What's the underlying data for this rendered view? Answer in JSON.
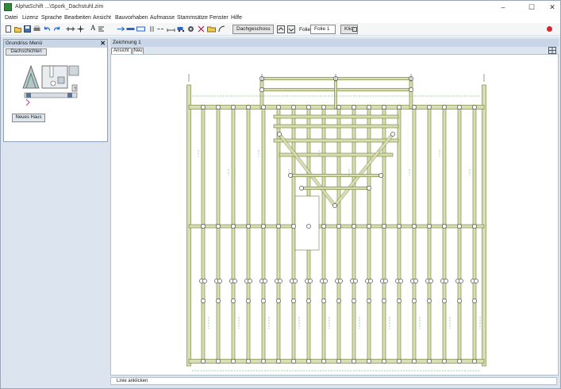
{
  "window": {
    "title": "AlphaSchift ...\\Spork_Dachstuhl.zim",
    "minimize": "–",
    "maximize": "☐",
    "close": "✕"
  },
  "menu": [
    "Datei",
    "Lizenz",
    "Sprache",
    "Bearbeiten",
    "Ansicht",
    "Bauvorhaben",
    "Aufmasse",
    "Stammsätze",
    "Fenster",
    "Hilfe"
  ],
  "toolbar": {
    "text_tool": "A",
    "floor_select": "Dachgeschoss",
    "folie_label": "Folie",
    "folie_value": "Folie 1",
    "klick_label": "Klick"
  },
  "left_panel": {
    "title": "Grundriss Menü",
    "close": "✕",
    "tab": "Dachschichten",
    "new_house": "Neues Haus"
  },
  "drawing": {
    "title": "Zeichnung 1",
    "btn_ansicht": "Ansicht",
    "btn_neu": "Neu"
  },
  "status": {
    "text": "Linie anklicken"
  },
  "colors": {
    "beam_fill": "#d8deb0",
    "beam_stroke": "#6f7a3a",
    "dim_line": "#3aa64a",
    "accent_red": "#d42a2a"
  }
}
